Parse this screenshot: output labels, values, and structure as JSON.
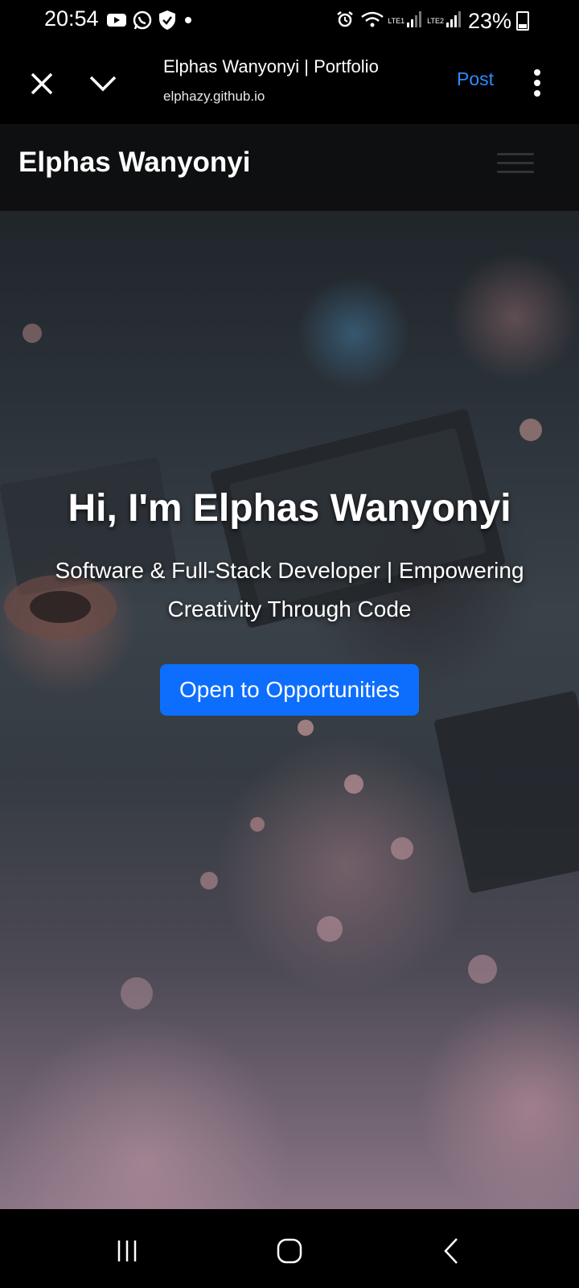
{
  "status_bar": {
    "time": "20:54",
    "battery_percent": "23%",
    "sim1_label": "LTE1",
    "sim2_label": "LTE2",
    "left_icons": [
      "youtube-icon",
      "whatsapp-icon",
      "shield-check-icon",
      "dot-icon"
    ],
    "right_icons": [
      "alarm-icon",
      "wifi-icon",
      "signal-icon",
      "signal-icon",
      "battery-icon"
    ]
  },
  "browser": {
    "page_title": "Elphas Wanyonyi | Portfolio",
    "host": "elphazy.github.io",
    "post_label": "Post",
    "accent_color": "#2b8cff"
  },
  "site": {
    "brand": "Elphas Wanyonyi",
    "hero": {
      "title": "Hi, I'm Elphas Wanyonyi",
      "subtitle": "Software & Full-Stack Developer | Empowering Creativity Through Code",
      "cta_label": "Open to Opportunities",
      "cta_color": "#0d6efd"
    }
  }
}
